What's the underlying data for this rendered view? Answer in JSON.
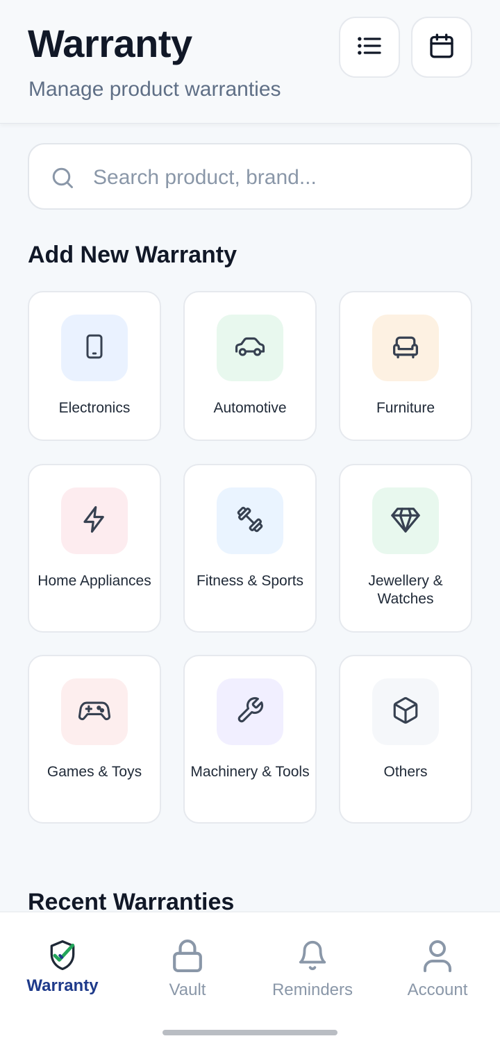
{
  "header": {
    "title": "Warranty",
    "subtitle": "Manage product warranties",
    "list_button_icon": "list-icon",
    "calendar_button_icon": "calendar-icon"
  },
  "search": {
    "placeholder": "Search product, brand...",
    "value": "",
    "icon": "search-icon"
  },
  "add_section": {
    "title": "Add New Warranty",
    "categories": [
      {
        "label": "Electronics",
        "icon": "smartphone-icon",
        "badge_color": "#eaf2ff"
      },
      {
        "label": "Automotive",
        "icon": "car-icon",
        "badge_color": "#e8f8ee"
      },
      {
        "label": "Furniture",
        "icon": "sofa-icon",
        "badge_color": "#fdf1e2"
      },
      {
        "label": "Home Appliances",
        "icon": "lightning-icon",
        "badge_color": "#fdecef"
      },
      {
        "label": "Fitness & Sports",
        "icon": "dumbbell-icon",
        "badge_color": "#eaf4ff"
      },
      {
        "label": "Jewellery & Watches",
        "icon": "diamond-icon",
        "badge_color": "#e8f8ee"
      },
      {
        "label": "Games & Toys",
        "icon": "gamepad-icon",
        "badge_color": "#fdeeee"
      },
      {
        "label": "Machinery & Tools",
        "icon": "wrench-icon",
        "badge_color": "#f1efff"
      },
      {
        "label": "Others",
        "icon": "box-icon",
        "badge_color": "#f5f7fa"
      }
    ]
  },
  "recent_section": {
    "title": "Recent Warranties"
  },
  "bottom_nav": {
    "items": [
      {
        "label": "Warranty",
        "icon": "shield-check-icon",
        "active": true
      },
      {
        "label": "Vault",
        "icon": "lock-icon",
        "active": false
      },
      {
        "label": "Reminders",
        "icon": "bell-icon",
        "active": false
      },
      {
        "label": "Account",
        "icon": "user-icon",
        "active": false
      }
    ]
  },
  "colors": {
    "accent": "#1e3a8a",
    "check_green": "#22a55a",
    "muted": "#8a97a8",
    "icon_stroke": "#374151"
  }
}
